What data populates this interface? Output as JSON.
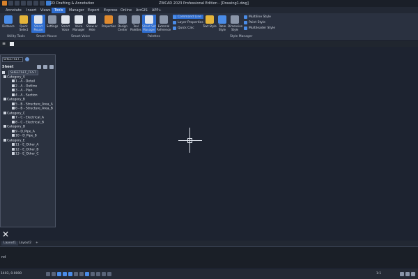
{
  "titlebar": {
    "workspace": "2D Drafting & Annotation",
    "title": "ZWCAD 2023 Professional Edition - [Drawing1.dwg]"
  },
  "menu_tabs": [
    "Annotate",
    "Insert",
    "Views",
    "Tools",
    "Manager",
    "Export",
    "Express",
    "Online",
    "ArcGIS",
    "APP+"
  ],
  "active_tab": "Tools",
  "ribbon": {
    "buttons": [
      {
        "label": "Distance",
        "icon": "measure-distance-icon"
      },
      {
        "label": "Quick Select",
        "icon": "quick-select-icon"
      },
      {
        "label": "Smart Mouse",
        "icon": "smart-mouse-icon"
      },
      {
        "label": "Settings",
        "icon": "settings-icon"
      },
      {
        "label": "Smart Voice",
        "icon": "microphone-icon"
      },
      {
        "label": "Voice Manager",
        "icon": "voice-manager-icon"
      },
      {
        "label": "Show or Hide",
        "icon": "show-hide-icon"
      },
      {
        "label": "Properties",
        "icon": "properties-icon"
      },
      {
        "label": "Design Center",
        "icon": "design-center-icon"
      },
      {
        "label": "Tool Palettes",
        "icon": "tool-palettes-icon"
      },
      {
        "label": "Sheet Set Manager",
        "icon": "sheet-set-icon"
      },
      {
        "label": "External Reference",
        "icon": "external-reference-icon"
      },
      {
        "label": "Text Style",
        "icon": "text-style-icon"
      },
      {
        "label": "Table Style",
        "icon": "table-style-icon"
      },
      {
        "label": "Dimension Style",
        "icon": "dimension-style-icon"
      }
    ],
    "small_buttons": {
      "palettes": [
        "Command Line",
        "Layer Properties",
        "Quick Calc"
      ],
      "style_manager": [
        "Multiline Style",
        "Point Style",
        "Multileader Style"
      ]
    },
    "panel_labels": [
      "Utility Tools",
      "Smart Mouse",
      "Smart Voice",
      "Palettes",
      "Style Manager"
    ]
  },
  "sheet_set": {
    "selector_value": "SHEETSET...",
    "header": "Sheet",
    "root_label": "SHEETSET_TEST",
    "categories": [
      {
        "name": "Category_A",
        "sheets": [
          "1 - A - Detail",
          "2 - A - Outline",
          "3 - A - Plan",
          "4 - A - Section"
        ]
      },
      {
        "name": "Category_B",
        "sheets": [
          "5 - B - Structure_Area_A",
          "6 - B - Structure_Area_B"
        ]
      },
      {
        "name": "Category_C",
        "sheets": [
          "7 - C - Electrical_A",
          "8 - C - Electrical_B"
        ]
      },
      {
        "name": "Category_D",
        "sheets": [
          "9 - D_Pipe_A",
          "10 - D_Pipe_B"
        ]
      },
      {
        "name": "Category_E",
        "sheets": [
          "11 - E_Other_A",
          "12 - E_Other_B",
          "13 - E_Other_C"
        ]
      }
    ]
  },
  "layout_tabs": [
    "Layout1",
    "Layout2",
    "+"
  ],
  "command_text": "nd",
  "status": {
    "coords": "1403, 0.0000",
    "annotation_scale": "1:1"
  },
  "colors": {
    "canvas": "#1d2330",
    "accent": "#2f6ed1",
    "ribbon": "#2a3140"
  }
}
